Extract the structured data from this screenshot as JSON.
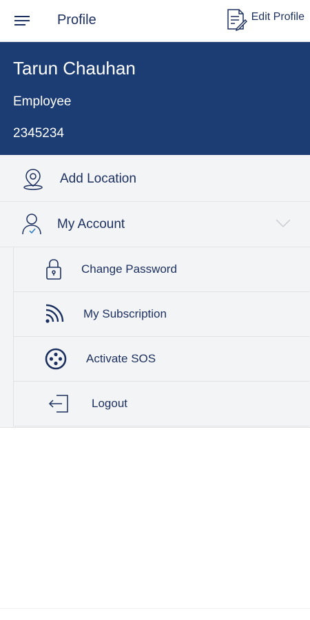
{
  "topbar": {
    "menu_icon": "hamburger-menu-icon",
    "title": "Profile",
    "edit_icon": "edit-document-icon",
    "edit_label": "Edit Profile"
  },
  "profile": {
    "name": "Tarun Chauhan",
    "role": "Employee",
    "id": "2345234"
  },
  "menu": {
    "add_location": {
      "label": "Add Location",
      "icon": "location-pin-icon"
    },
    "my_account": {
      "label": "My Account",
      "icon": "user-icon",
      "expand_icon": "chevron-down-icon"
    }
  },
  "submenu": [
    {
      "label": "Change Password",
      "icon": "lock-icon"
    },
    {
      "label": "My Subscription",
      "icon": "rss-feed-icon"
    },
    {
      "label": "Activate SOS",
      "icon": "sos-dots-icon"
    },
    {
      "label": "Logout",
      "icon": "logout-icon"
    }
  ],
  "colors": {
    "header_background": "#1c3d73",
    "text_primary": "#1b2f5e",
    "row_background": "#f3f4f6"
  }
}
